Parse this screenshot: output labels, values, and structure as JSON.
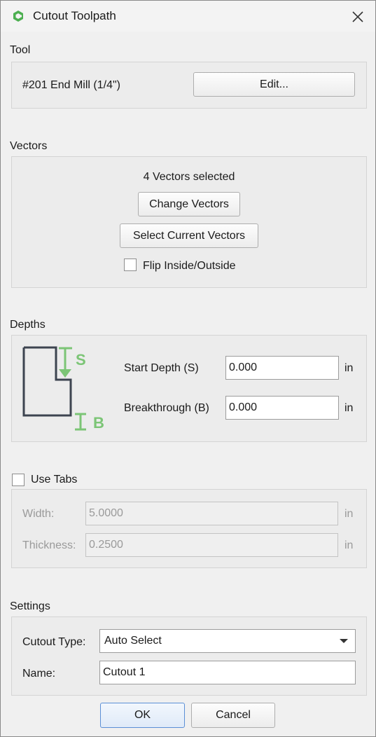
{
  "window": {
    "title": "Cutout Toolpath",
    "icon": "app-logo-icon",
    "close_icon": "close-icon"
  },
  "tool": {
    "section_label": "Tool",
    "name": "#201 End Mill (1/4\")",
    "edit_label": "Edit..."
  },
  "vectors": {
    "section_label": "Vectors",
    "selected_text": "4 Vectors selected",
    "change_label": "Change Vectors",
    "select_current_label": "Select Current Vectors",
    "flip_label": "Flip Inside/Outside",
    "flip_checked": false
  },
  "depths": {
    "section_label": "Depths",
    "diagram_s": "S",
    "diagram_b": "B",
    "start_label": "Start Depth (S)",
    "start_value": "0.000",
    "start_unit": "in",
    "breakthrough_label": "Breakthrough (B)",
    "breakthrough_value": "0.000",
    "breakthrough_unit": "in",
    "accent_color": "#7cc576",
    "shape_color": "#3d4450"
  },
  "tabs": {
    "use_label": "Use Tabs",
    "use_checked": false,
    "width_label": "Width:",
    "width_value": "5.0000",
    "width_unit": "in",
    "thickness_label": "Thickness:",
    "thickness_value": "0.2500",
    "thickness_unit": "in"
  },
  "settings": {
    "section_label": "Settings",
    "cutout_type_label": "Cutout Type:",
    "cutout_type_value": "Auto Select",
    "name_label": "Name:",
    "name_value": "Cutout 1"
  },
  "footer": {
    "ok_label": "OK",
    "cancel_label": "Cancel"
  }
}
